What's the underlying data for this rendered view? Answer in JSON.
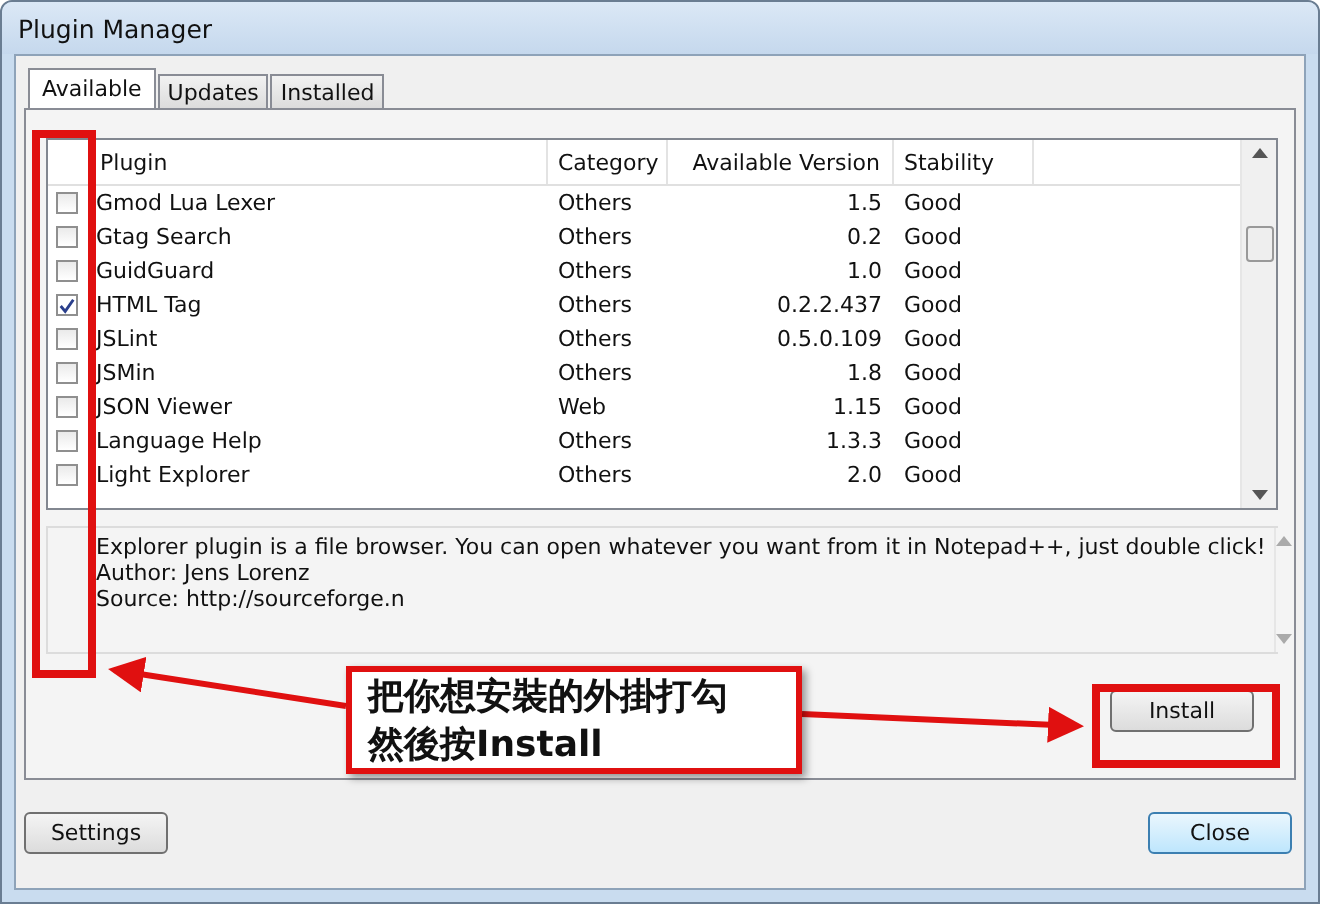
{
  "window": {
    "title": "Plugin Manager"
  },
  "tabs": [
    {
      "label": "Available",
      "selected": true
    },
    {
      "label": "Updates",
      "selected": false
    },
    {
      "label": "Installed",
      "selected": false
    }
  ],
  "table": {
    "columns": [
      "Plugin",
      "Category",
      "Available Version",
      "Stability"
    ],
    "rows": [
      {
        "plugin": "Gmod Lua Lexer",
        "category": "Others",
        "version": "1.5",
        "stability": "Good",
        "checked": false
      },
      {
        "plugin": "Gtag Search",
        "category": "Others",
        "version": "0.2",
        "stability": "Good",
        "checked": false
      },
      {
        "plugin": "GuidGuard",
        "category": "Others",
        "version": "1.0",
        "stability": "Good",
        "checked": false
      },
      {
        "plugin": "HTML Tag",
        "category": "Others",
        "version": "0.2.2.437",
        "stability": "Good",
        "checked": true
      },
      {
        "plugin": "JSLint",
        "category": "Others",
        "version": "0.5.0.109",
        "stability": "Good",
        "checked": false
      },
      {
        "plugin": "JSMin",
        "category": "Others",
        "version": "1.8",
        "stability": "Good",
        "checked": false
      },
      {
        "plugin": "JSON Viewer",
        "category": "Web",
        "version": "1.15",
        "stability": "Good",
        "checked": false
      },
      {
        "plugin": "Language Help",
        "category": "Others",
        "version": "1.3.3",
        "stability": "Good",
        "checked": false
      },
      {
        "plugin": "Light Explorer",
        "category": "Others",
        "version": "2.0",
        "stability": "Good",
        "checked": false
      }
    ]
  },
  "description": [
    "Explorer plugin is a file browser. You can open whatever you want from it in Notepad++, just double click!",
    "Author: Jens Lorenz",
    "Source: http://sourceforge.n"
  ],
  "install_button": "Install",
  "settings_button": "Settings",
  "close_button": "Close",
  "callout": [
    "把你想安裝的外掛打勾",
    "然後按Install"
  ]
}
